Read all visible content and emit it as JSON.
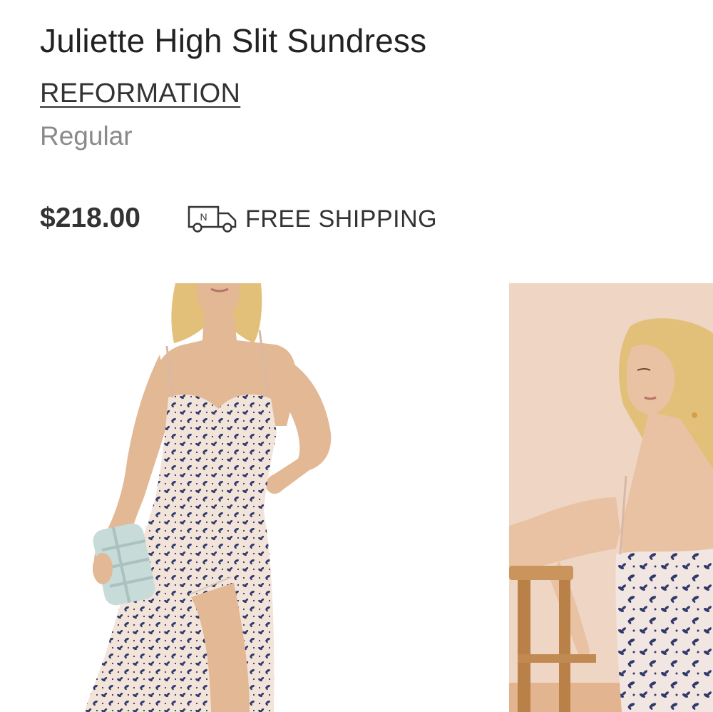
{
  "product": {
    "title": "Juliette High Slit Sundress",
    "brand": "REFORMATION",
    "fit": "Regular",
    "price": "$218.00",
    "shipping_label": "FREE SHIPPING",
    "shipping_icon": "delivery-truck-icon",
    "truck_badge_letter": "N"
  },
  "gallery": {
    "images": [
      {
        "name": "model-front-photo",
        "alt": "Model wearing floral high slit sundress holding mint clutch"
      },
      {
        "name": "model-seated-photo",
        "alt": "Model seated by wooden stool wearing floral sundress"
      }
    ]
  },
  "colors": {
    "text": "#222222",
    "muted": "#8a8a8a",
    "dress_base": "#f3e4da",
    "dress_print": "#2f3a6b",
    "skin": "#e2b895",
    "hair": "#e3c07a",
    "backdrop": "#efd6c4",
    "wood": "#c9955d",
    "clutch": "#c7dbd8"
  }
}
